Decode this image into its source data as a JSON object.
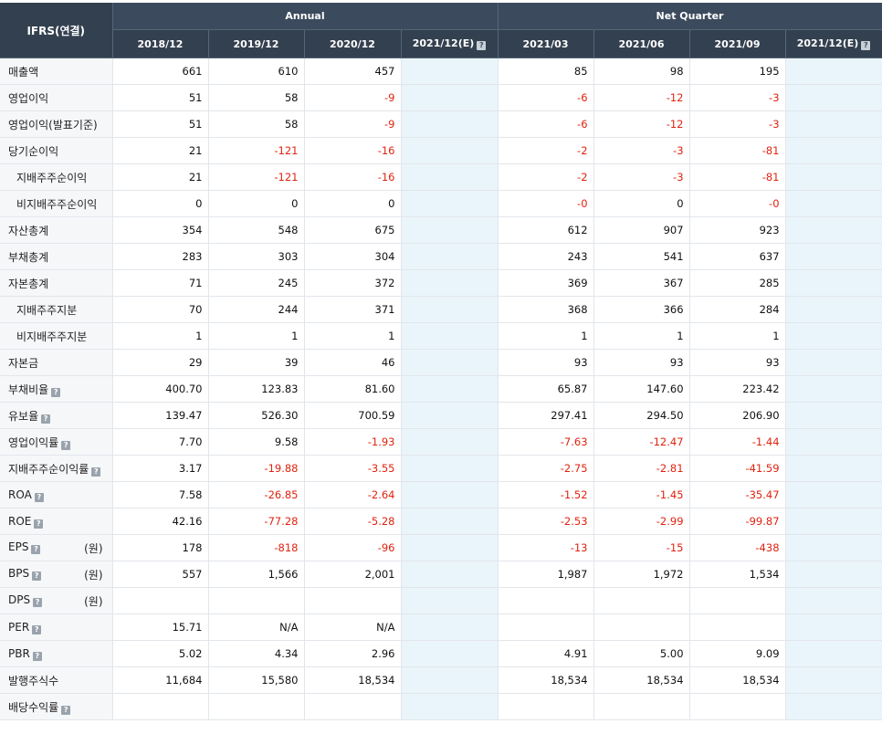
{
  "header": {
    "corner_label": "IFRS(연결)",
    "group_annual": "Annual",
    "group_quarter": "Net Quarter",
    "periods": [
      "2018/12",
      "2019/12",
      "2020/12",
      "2021/12(E)",
      "2021/03",
      "2021/06",
      "2021/09",
      "2021/12(E)"
    ],
    "estimate_columns": [
      3,
      7
    ]
  },
  "rows": [
    {
      "label": "매출액",
      "indent": false,
      "help": false,
      "unit": "",
      "values": [
        "661",
        "610",
        "457",
        "",
        "85",
        "98",
        "195",
        ""
      ]
    },
    {
      "label": "영업이익",
      "indent": false,
      "help": false,
      "unit": "",
      "values": [
        "51",
        "58",
        "-9",
        "",
        "-6",
        "-12",
        "-3",
        ""
      ]
    },
    {
      "label": "영업이익(발표기준)",
      "indent": false,
      "help": false,
      "unit": "",
      "values": [
        "51",
        "58",
        "-9",
        "",
        "-6",
        "-12",
        "-3",
        ""
      ]
    },
    {
      "label": "당기순이익",
      "indent": false,
      "help": false,
      "unit": "",
      "values": [
        "21",
        "-121",
        "-16",
        "",
        "-2",
        "-3",
        "-81",
        ""
      ]
    },
    {
      "label": "지배주주순이익",
      "indent": true,
      "help": false,
      "unit": "",
      "values": [
        "21",
        "-121",
        "-16",
        "",
        "-2",
        "-3",
        "-81",
        ""
      ]
    },
    {
      "label": "비지배주주순이익",
      "indent": true,
      "help": false,
      "unit": "",
      "values": [
        "0",
        "0",
        "0",
        "",
        "-0",
        "0",
        "-0",
        ""
      ]
    },
    {
      "label": "자산총계",
      "indent": false,
      "help": false,
      "unit": "",
      "values": [
        "354",
        "548",
        "675",
        "",
        "612",
        "907",
        "923",
        ""
      ]
    },
    {
      "label": "부채총계",
      "indent": false,
      "help": false,
      "unit": "",
      "values": [
        "283",
        "303",
        "304",
        "",
        "243",
        "541",
        "637",
        ""
      ]
    },
    {
      "label": "자본총계",
      "indent": false,
      "help": false,
      "unit": "",
      "values": [
        "71",
        "245",
        "372",
        "",
        "369",
        "367",
        "285",
        ""
      ]
    },
    {
      "label": "지배주주지분",
      "indent": true,
      "help": false,
      "unit": "",
      "values": [
        "70",
        "244",
        "371",
        "",
        "368",
        "366",
        "284",
        ""
      ]
    },
    {
      "label": "비지배주주지분",
      "indent": true,
      "help": false,
      "unit": "",
      "values": [
        "1",
        "1",
        "1",
        "",
        "1",
        "1",
        "1",
        ""
      ]
    },
    {
      "label": "자본금",
      "indent": false,
      "help": false,
      "unit": "",
      "values": [
        "29",
        "39",
        "46",
        "",
        "93",
        "93",
        "93",
        ""
      ]
    },
    {
      "label": "부채비율",
      "indent": false,
      "help": true,
      "unit": "",
      "values": [
        "400.70",
        "123.83",
        "81.60",
        "",
        "65.87",
        "147.60",
        "223.42",
        ""
      ]
    },
    {
      "label": "유보율",
      "indent": false,
      "help": true,
      "unit": "",
      "values": [
        "139.47",
        "526.30",
        "700.59",
        "",
        "297.41",
        "294.50",
        "206.90",
        ""
      ]
    },
    {
      "label": "영업이익률",
      "indent": false,
      "help": true,
      "unit": "",
      "values": [
        "7.70",
        "9.58",
        "-1.93",
        "",
        "-7.63",
        "-12.47",
        "-1.44",
        ""
      ]
    },
    {
      "label": "지배주주순이익률",
      "indent": false,
      "help": true,
      "unit": "",
      "values": [
        "3.17",
        "-19.88",
        "-3.55",
        "",
        "-2.75",
        "-2.81",
        "-41.59",
        ""
      ]
    },
    {
      "label": "ROA",
      "indent": false,
      "help": true,
      "unit": "",
      "values": [
        "7.58",
        "-26.85",
        "-2.64",
        "",
        "-1.52",
        "-1.45",
        "-35.47",
        ""
      ]
    },
    {
      "label": "ROE",
      "indent": false,
      "help": true,
      "unit": "",
      "values": [
        "42.16",
        "-77.28",
        "-5.28",
        "",
        "-2.53",
        "-2.99",
        "-99.87",
        ""
      ]
    },
    {
      "label": "EPS",
      "indent": false,
      "help": true,
      "unit": "(원)",
      "values": [
        "178",
        "-818",
        "-96",
        "",
        "-13",
        "-15",
        "-438",
        ""
      ]
    },
    {
      "label": "BPS",
      "indent": false,
      "help": true,
      "unit": "(원)",
      "values": [
        "557",
        "1,566",
        "2,001",
        "",
        "1,987",
        "1,972",
        "1,534",
        ""
      ]
    },
    {
      "label": "DPS",
      "indent": false,
      "help": true,
      "unit": "(원)",
      "values": [
        "",
        "",
        "",
        "",
        "",
        "",
        "",
        ""
      ]
    },
    {
      "label": "PER",
      "indent": false,
      "help": true,
      "unit": "",
      "values": [
        "15.71",
        "N/A",
        "N/A",
        "",
        "",
        "",
        "",
        ""
      ]
    },
    {
      "label": "PBR",
      "indent": false,
      "help": true,
      "unit": "",
      "values": [
        "5.02",
        "4.34",
        "2.96",
        "",
        "4.91",
        "5.00",
        "9.09",
        ""
      ]
    },
    {
      "label": "발행주식수",
      "indent": false,
      "help": false,
      "unit": "",
      "values": [
        "11,684",
        "15,580",
        "18,534",
        "",
        "18,534",
        "18,534",
        "18,534",
        ""
      ]
    },
    {
      "label": "배당수익률",
      "indent": false,
      "help": true,
      "unit": "",
      "values": [
        "",
        "",
        "",
        "",
        "",
        "",
        "",
        ""
      ]
    }
  ],
  "colors": {
    "header_bg": "#3c4a5d",
    "negative": "#e0230f",
    "estimate_bg": "#eaf5fb",
    "label_bg": "#f6f7f9"
  },
  "icons": {
    "help": "question-mark-icon"
  }
}
